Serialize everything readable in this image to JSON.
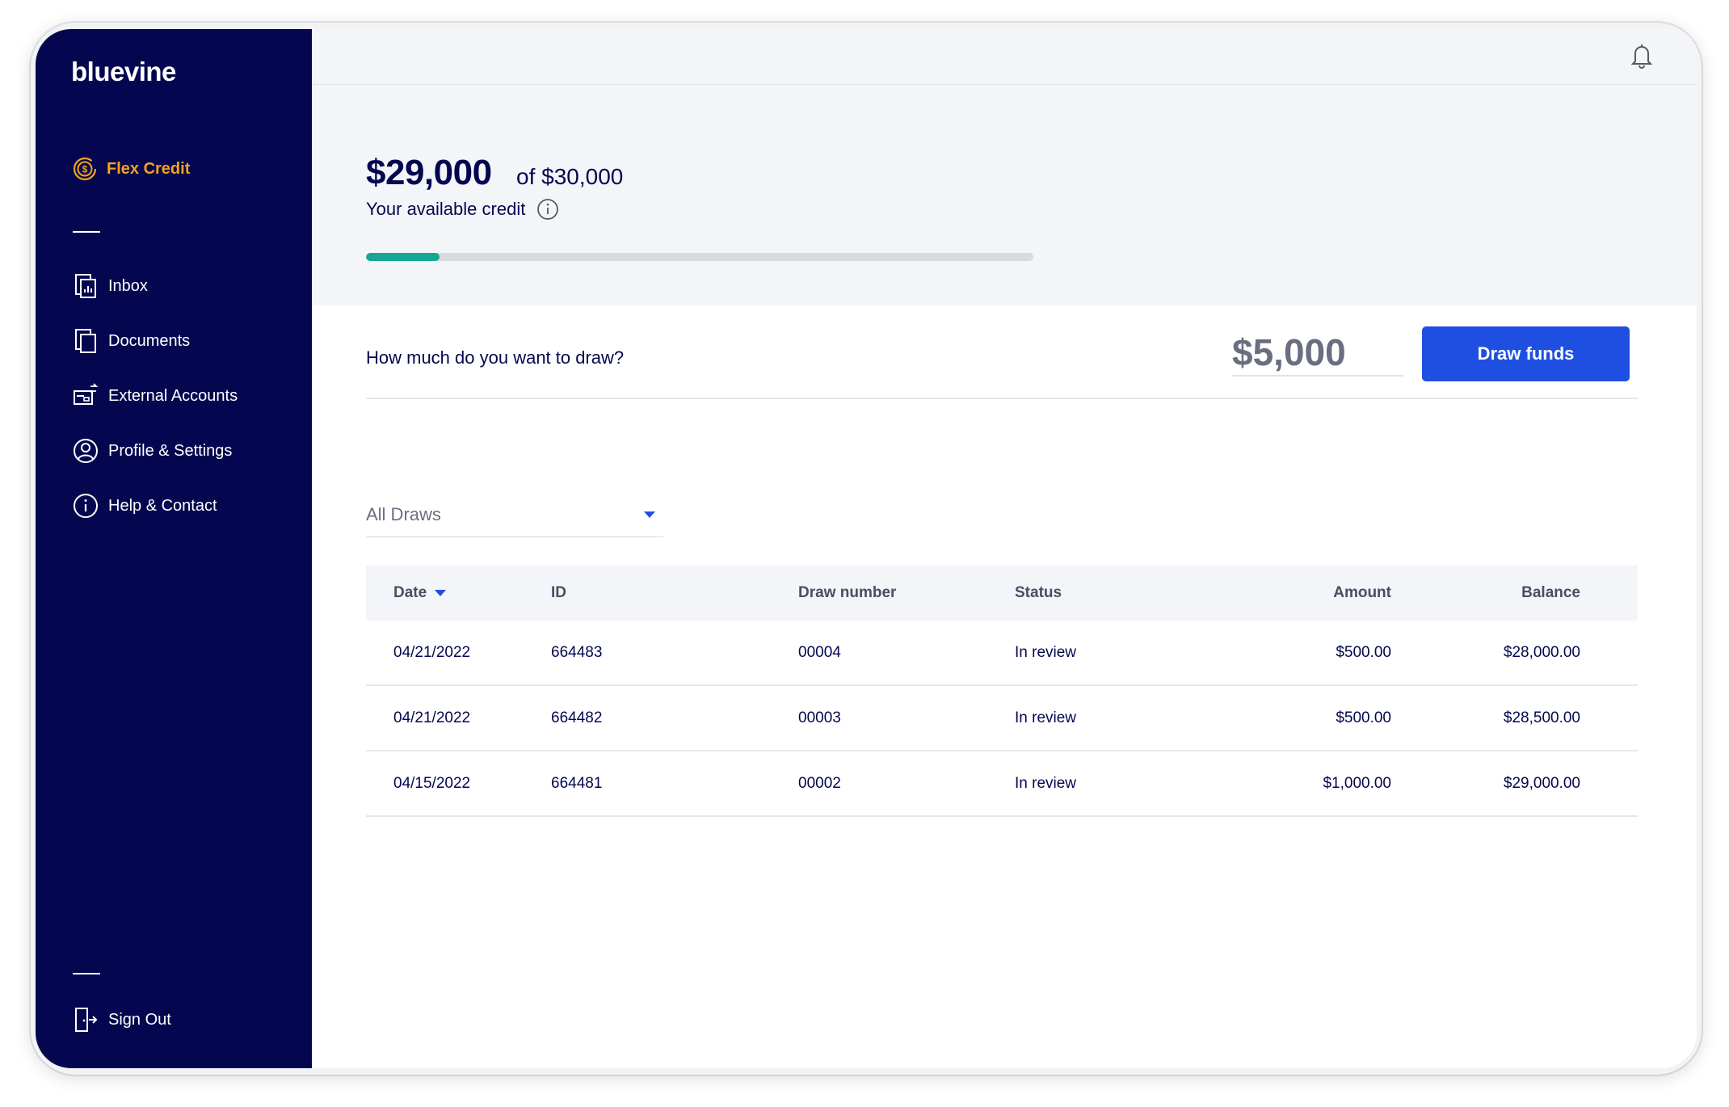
{
  "brand": {
    "logo_text": "bluevine"
  },
  "sidebar": {
    "active_item": {
      "label": "Flex Credit",
      "icon": "dollar-refresh-icon"
    },
    "items": [
      {
        "label": "Inbox",
        "icon": "inbox-icon"
      },
      {
        "label": "Documents",
        "icon": "documents-icon"
      },
      {
        "label": "External Accounts",
        "icon": "bank-transfer-icon"
      },
      {
        "label": "Profile & Settings",
        "icon": "user-icon"
      },
      {
        "label": "Help & Contact",
        "icon": "info-icon"
      }
    ],
    "sign_out": {
      "label": "Sign Out",
      "icon": "sign-out-icon"
    }
  },
  "header": {
    "notifications_icon": "bell-icon"
  },
  "credit": {
    "available": "$29,000",
    "limit_text": "of $30,000",
    "label": "Your available credit",
    "used_fraction": 0.11,
    "bar_color": "#17a696"
  },
  "draw": {
    "question": "How much do you want to draw?",
    "amount_value": "$5,000",
    "button_label": "Draw funds",
    "button_color": "#1e4fe0"
  },
  "filter": {
    "selected": "All Draws"
  },
  "table": {
    "headers": {
      "date": "Date",
      "id": "ID",
      "draw_number": "Draw number",
      "status": "Status",
      "amount": "Amount",
      "balance": "Balance"
    },
    "rows": [
      {
        "date": "04/21/2022",
        "id": "664483",
        "draw_number": "00004",
        "status": "In review",
        "amount": "$500.00",
        "balance": "$28,000.00"
      },
      {
        "date": "04/21/2022",
        "id": "664482",
        "draw_number": "00003",
        "status": "In review",
        "amount": "$500.00",
        "balance": "$28,500.00"
      },
      {
        "date": "04/15/2022",
        "id": "664481",
        "draw_number": "00002",
        "status": "In review",
        "amount": "$1,000.00",
        "balance": "$29,000.00"
      }
    ]
  },
  "colors": {
    "sidebar_bg": "#04074f",
    "accent_orange": "#f7a21b",
    "primary_blue": "#1e4fe0",
    "teal": "#17a696"
  }
}
